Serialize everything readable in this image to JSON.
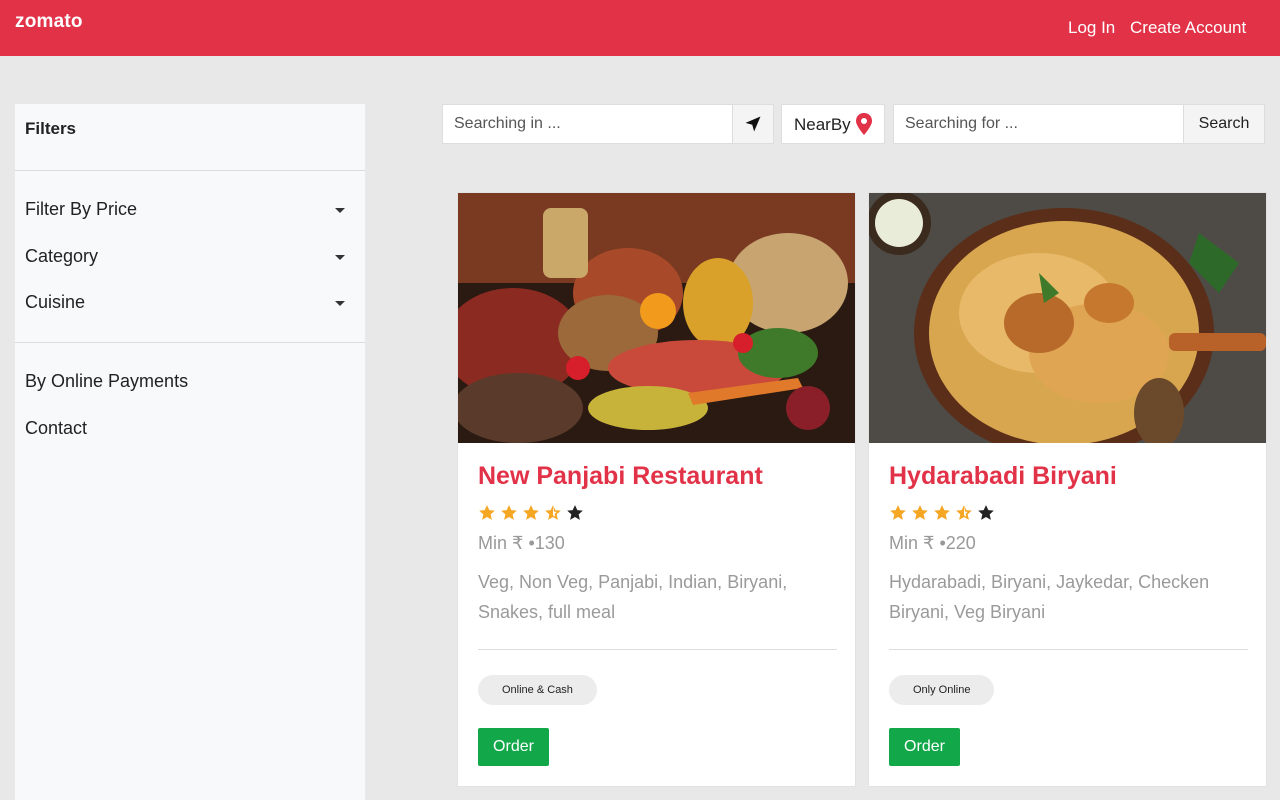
{
  "header": {
    "brand": "zomato",
    "login_label": "Log In",
    "create_account_label": "Create Account"
  },
  "sidebar": {
    "title": "Filters",
    "dropdowns": [
      "Filter By Price",
      "Category",
      "Cuisine"
    ],
    "links": [
      "By Online Payments",
      "Contact"
    ]
  },
  "search": {
    "location_placeholder": "Searching in ...",
    "nearby_label": "NearBy",
    "query_placeholder": "Searching for ...",
    "search_button": "Search"
  },
  "restaurants": [
    {
      "name": "New Panjabi Restaurant",
      "rating": 3.5,
      "rating_max": 5,
      "min_price": "Min ₹ •130",
      "cuisines": "Veg, Non Veg, Panjabi, Indian, Biryani, Snakes, full meal",
      "payment": "Online & Cash",
      "order_label": "Order"
    },
    {
      "name": "Hydarabadi Biryani",
      "rating": 3.5,
      "rating_max": 5,
      "min_price": "Min ₹ •220",
      "cuisines": "Hydarabadi, Biryani, Jaykedar, Checken Biryani, Veg Biryani",
      "payment": "Only Online",
      "order_label": "Order"
    }
  ],
  "colors": {
    "brand_red": "#e23248",
    "star_orange": "#f5a623",
    "order_green": "#12a84a"
  }
}
